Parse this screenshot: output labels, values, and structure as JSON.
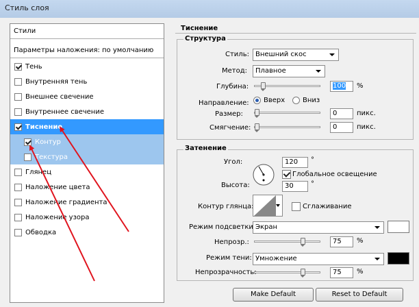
{
  "window": {
    "title": "Стиль слоя"
  },
  "styles_panel": {
    "header": "Стили",
    "blending_options": "Параметры наложения: по умолчанию",
    "items": [
      {
        "label": "Тень",
        "checked": true,
        "bold": false,
        "selected": false,
        "sub": false,
        "disabled": false
      },
      {
        "label": "Внутренняя тень",
        "checked": false,
        "bold": false,
        "selected": false,
        "sub": false,
        "disabled": false
      },
      {
        "label": "Внешнее свечение",
        "checked": false,
        "bold": false,
        "selected": false,
        "sub": false,
        "disabled": false
      },
      {
        "label": "Внутреннее свечение",
        "checked": false,
        "bold": false,
        "selected": false,
        "sub": false,
        "disabled": false
      },
      {
        "label": "Тиснение",
        "checked": true,
        "bold": true,
        "selected": true,
        "sub": false,
        "disabled": false
      },
      {
        "label": "Контур",
        "checked": true,
        "bold": false,
        "selected": true,
        "sub": true,
        "disabled": false
      },
      {
        "label": "Текстура",
        "checked": false,
        "bold": false,
        "selected": true,
        "sub": true,
        "disabled": false
      },
      {
        "label": "Глянец",
        "checked": false,
        "bold": false,
        "selected": false,
        "sub": false,
        "disabled": false
      },
      {
        "label": "Наложение цвета",
        "checked": false,
        "bold": false,
        "selected": false,
        "sub": false,
        "disabled": false
      },
      {
        "label": "Наложение градиента",
        "checked": false,
        "bold": false,
        "selected": false,
        "sub": false,
        "disabled": false
      },
      {
        "label": "Наложение узора",
        "checked": false,
        "bold": false,
        "selected": false,
        "sub": false,
        "disabled": false
      },
      {
        "label": "Обводка",
        "checked": false,
        "bold": false,
        "selected": false,
        "sub": false,
        "disabled": false
      }
    ]
  },
  "bevel": {
    "section_title": "Тиснение",
    "structure": {
      "title": "Структура",
      "style_label": "Стиль:",
      "style_value": "Внешний скос",
      "method_label": "Метод:",
      "method_value": "Плавное",
      "depth_label": "Глубина:",
      "depth_value": "100",
      "depth_unit": "%",
      "depth_level": 0.1,
      "direction_label": "Направление:",
      "direction_up": "Вверх",
      "direction_down": "Вниз",
      "direction_selected": "up",
      "size_label": "Размер:",
      "size_value": "0",
      "size_unit": "пикс.",
      "size_level": 0.0,
      "soften_label": "Смягчение:",
      "soften_value": "0",
      "soften_unit": "пикс.",
      "soften_level": 0.0
    },
    "shading": {
      "title": "Затенение",
      "angle_label": "Угол:",
      "angle_value": "120",
      "angle_unit": "°",
      "global_light_label": "Глобальное освещение",
      "global_light_checked": true,
      "altitude_label": "Высота:",
      "altitude_value": "30",
      "altitude_unit": "°",
      "gloss_contour_label": "Контур глянца:",
      "antialias_label": "Сглаживание",
      "antialias_checked": false,
      "highlight_mode_label": "Режим подсветки:",
      "highlight_mode_value": "Экран",
      "highlight_color": "#ffffff",
      "highlight_opacity_label": "Непрозр.:",
      "highlight_opacity_value": "75",
      "highlight_opacity_unit": "%",
      "highlight_opacity_level": 0.75,
      "shadow_mode_label": "Режим тени:",
      "shadow_mode_value": "Умножение",
      "shadow_color": "#000000",
      "shadow_opacity_label": "Непрозрачность:",
      "shadow_opacity_value": "75",
      "shadow_opacity_unit": "%",
      "shadow_opacity_level": 0.75
    },
    "buttons": {
      "make_default": "Make Default",
      "reset_default": "Reset to Default"
    }
  },
  "colors": {
    "selection": "#3399ff",
    "selection_sub": "#9dc6ee",
    "annotation_arrow": "#e0141e"
  }
}
